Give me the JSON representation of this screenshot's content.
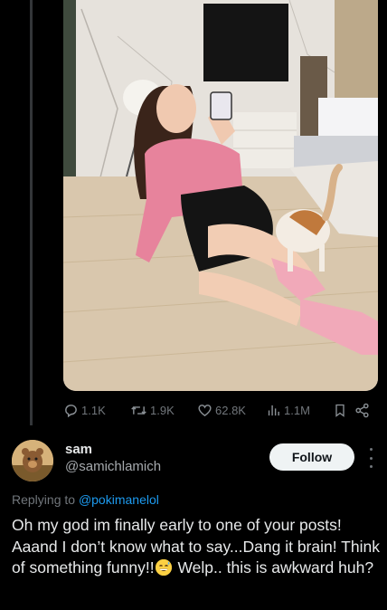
{
  "post": {
    "media_alt": "photo",
    "stats": {
      "replies": "1.1K",
      "retweets": "1.9K",
      "likes": "62.8K",
      "views": "1.1M"
    }
  },
  "reply": {
    "author_name": "sam",
    "author_handle": "@samichlamich",
    "follow_label": "Follow",
    "replying_prefix": "Replying to ",
    "replying_handle": "@pokimanelol",
    "text_part1": "Oh my god im finally early to one of your posts! Aaand I don’t know what to say...Dang it brain! Think of something funny!!",
    "emoji": "sweat-smile-emoji",
    "text_part2": " Welp.. this is awkward huh?"
  },
  "colors": {
    "background": "#000000",
    "text": "#e7e9ea",
    "muted": "#71767b",
    "link": "#1d9bf0",
    "follow_bg": "#eff3f4"
  }
}
